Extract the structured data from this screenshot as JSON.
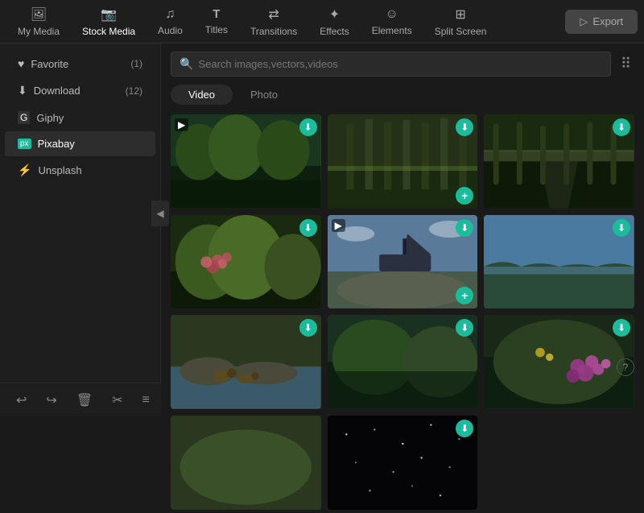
{
  "nav": {
    "items": [
      {
        "id": "my-media",
        "label": "My Media",
        "icon": "🖼"
      },
      {
        "id": "stock-media",
        "label": "Stock Media",
        "icon": "📷",
        "active": true
      },
      {
        "id": "audio",
        "label": "Audio",
        "icon": "♪"
      },
      {
        "id": "titles",
        "label": "Titles",
        "icon": "T"
      },
      {
        "id": "transitions",
        "label": "Transitions",
        "icon": "⊳⊲"
      },
      {
        "id": "effects",
        "label": "Effects",
        "icon": "✦"
      },
      {
        "id": "elements",
        "label": "Elements",
        "icon": "☺"
      },
      {
        "id": "split-screen",
        "label": "Split Screen",
        "icon": "⊞"
      }
    ],
    "export_label": "Export"
  },
  "sidebar": {
    "items": [
      {
        "id": "favorite",
        "label": "Favorite",
        "icon": "♥",
        "count": "(1)"
      },
      {
        "id": "download",
        "label": "Download",
        "icon": "⬇",
        "count": "(12)"
      },
      {
        "id": "giphy",
        "label": "Giphy",
        "icon": "G"
      },
      {
        "id": "pixabay",
        "label": "Pixabay",
        "icon": "px",
        "active": true
      },
      {
        "id": "unsplash",
        "label": "Unsplash",
        "icon": "⚡"
      }
    ]
  },
  "search": {
    "placeholder": "Search images,vectors,videos",
    "value": ""
  },
  "content_tabs": [
    {
      "id": "video",
      "label": "Video",
      "active": true
    },
    {
      "id": "photo",
      "label": "Photo",
      "active": false
    }
  ],
  "media_grid": {
    "items": [
      {
        "id": 1,
        "bg": "bg-forest",
        "has_video_icon": true,
        "has_download": true,
        "has_add": false
      },
      {
        "id": 2,
        "bg": "bg-trees",
        "has_video_icon": false,
        "has_download": true,
        "has_add": true
      },
      {
        "id": 3,
        "bg": "bg-avenue",
        "has_video_icon": false,
        "has_download": true,
        "has_add": false
      },
      {
        "id": 4,
        "bg": "bg-flowers",
        "has_video_icon": false,
        "has_download": true,
        "has_add": false
      },
      {
        "id": 5,
        "bg": "bg-ship",
        "has_video_icon": true,
        "has_download": true,
        "has_add": true
      },
      {
        "id": 6,
        "bg": "bg-coast",
        "has_video_icon": false,
        "has_download": true,
        "has_add": false
      },
      {
        "id": 7,
        "bg": "bg-ducks",
        "has_video_icon": false,
        "has_download": true,
        "has_add": false
      },
      {
        "id": 8,
        "bg": "bg-meadow",
        "has_video_icon": false,
        "has_download": true,
        "has_add": false
      },
      {
        "id": 9,
        "bg": "bg-flowers2",
        "has_video_icon": false,
        "has_download": true,
        "has_add": false
      },
      {
        "id": 10,
        "bg": "bg-partial",
        "has_video_icon": false,
        "has_download": false,
        "has_add": false
      },
      {
        "id": 11,
        "bg": "bg-dark",
        "has_video_icon": false,
        "has_download": true,
        "has_add": false
      }
    ]
  },
  "toolbar": {
    "buttons": [
      "↩",
      "↪",
      "🗑",
      "✂",
      "≡"
    ]
  },
  "icons": {
    "search": "🔍",
    "grid": "⠿",
    "chevron_left": "◀",
    "help": "?"
  }
}
